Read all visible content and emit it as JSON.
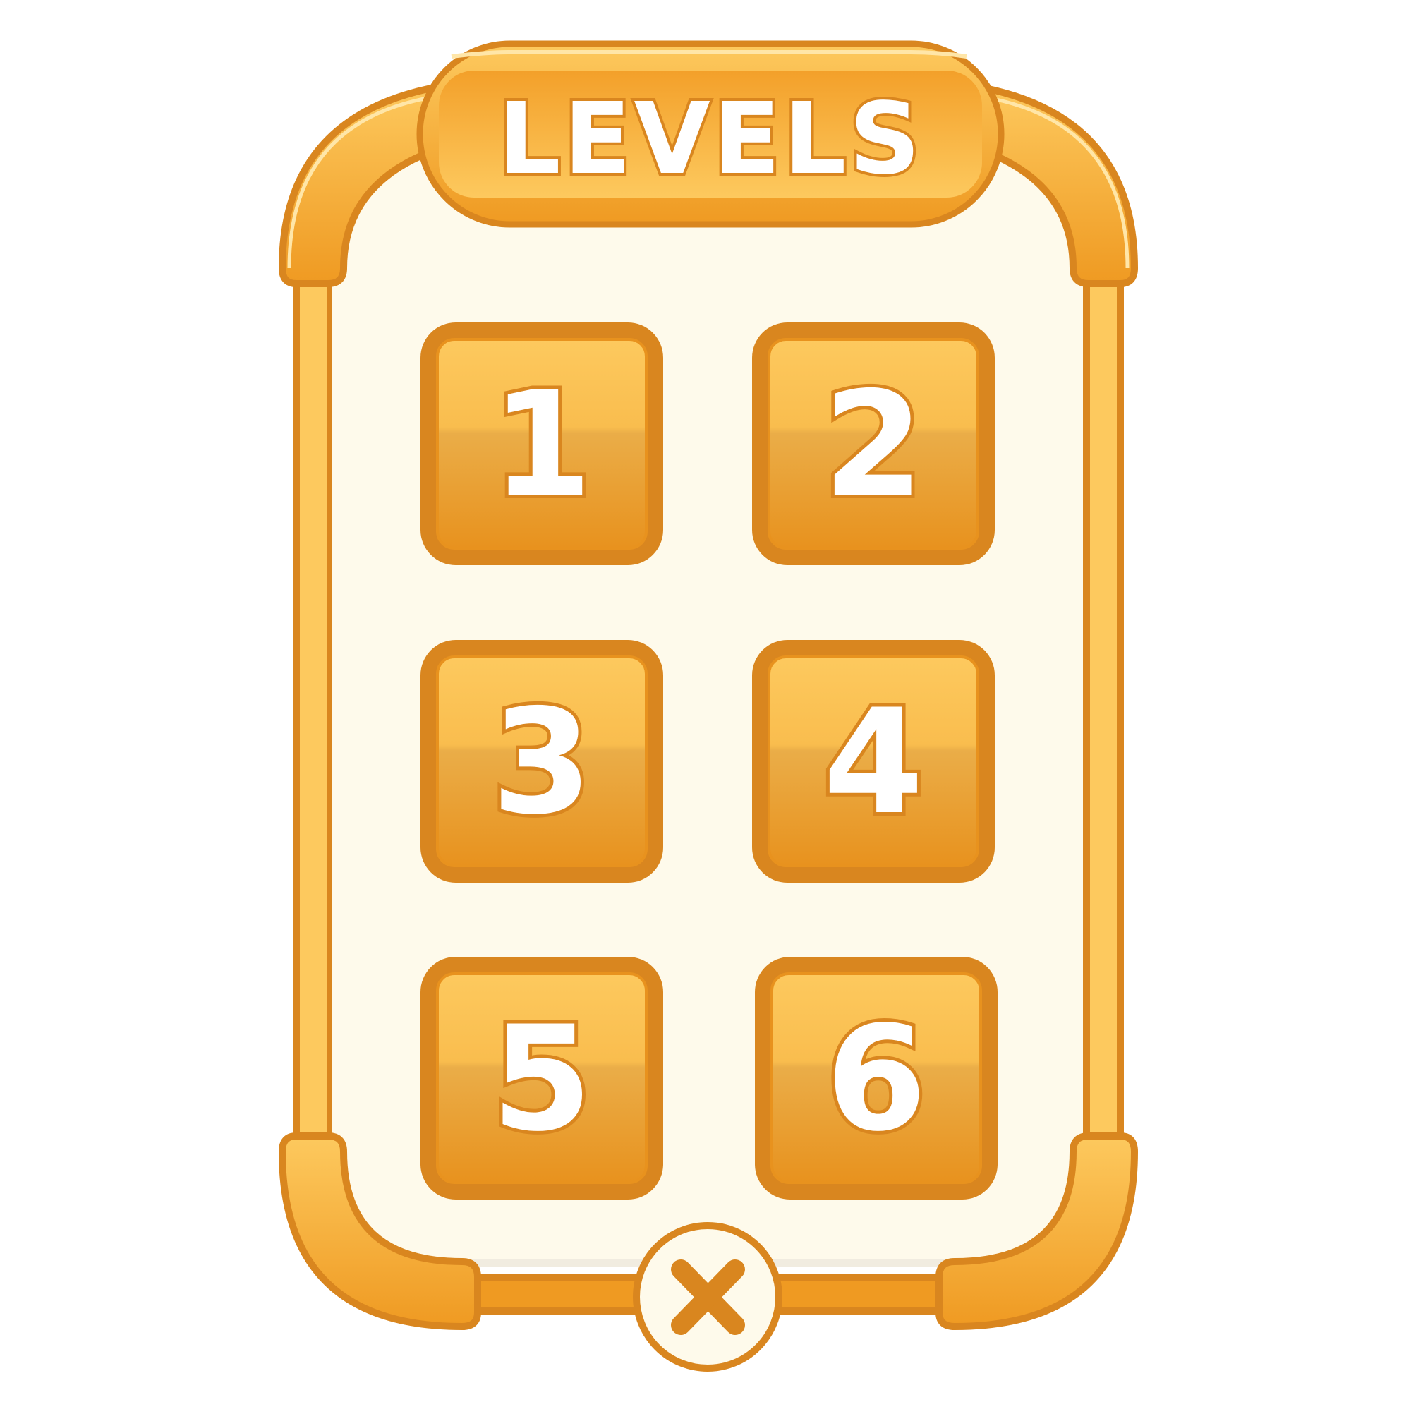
{
  "window": {
    "title": "LEVELS"
  },
  "levels": [
    {
      "label": "1"
    },
    {
      "label": "2"
    },
    {
      "label": "3"
    },
    {
      "label": "4"
    },
    {
      "label": "5"
    },
    {
      "label": "6"
    }
  ],
  "close": {
    "icon": "close-icon"
  },
  "colors": {
    "outline": "#d9861f",
    "orange_dark": "#ef9a22",
    "orange_light": "#fdc95e",
    "panel_bg": "#fefaeb",
    "text_fill": "#ffffff"
  }
}
